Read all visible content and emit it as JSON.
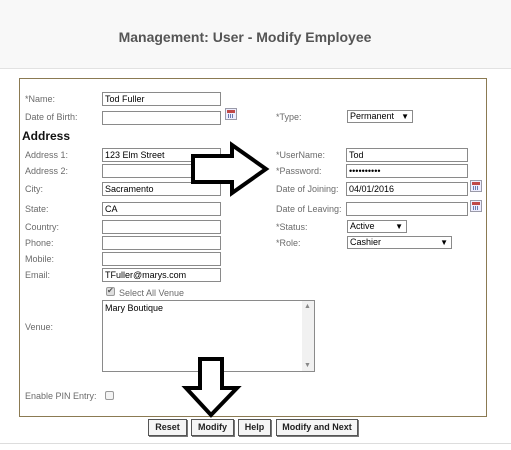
{
  "page_title": "Management: User - Modify Employee",
  "left": {
    "name_label": "*Name:",
    "name_value": "Tod Fuller",
    "dob_label": "Date of Birth:",
    "dob_value": "",
    "address_heading": "Address",
    "address1_label": "Address 1:",
    "address1_value": "123 Elm Street",
    "address2_label": "Address 2:",
    "address2_value": "",
    "city_label": "City:",
    "city_value": "Sacramento",
    "state_label": "State:",
    "state_value": "CA",
    "country_label": "Country:",
    "country_value": "",
    "phone_label": "Phone:",
    "phone_value": "",
    "mobile_label": "Mobile:",
    "mobile_value": "",
    "email_label": "Email:",
    "email_value": "TFuller@marys.com",
    "select_all_venue_label": "Select All Venue",
    "select_all_venue_checked": true,
    "venue_label": "Venue:",
    "venue_items": [
      "Mary Boutique"
    ],
    "pin_label": "Enable PIN Entry:",
    "pin_checked": false
  },
  "right": {
    "type_label": "*Type:",
    "type_value": "Permanent",
    "username_label": "*UserName:",
    "username_value": "Tod",
    "password_label": "*Password:",
    "password_value": "••••••••••",
    "doj_label": "Date of Joining:",
    "doj_value": "04/01/2016",
    "dol_label": "Date of Leaving:",
    "dol_value": "",
    "status_label": "*Status:",
    "status_value": "Active",
    "role_label": "*Role:",
    "role_value": "Cashier"
  },
  "buttons": {
    "reset": "Reset",
    "modify": "Modify",
    "help": "Help",
    "modify_next": "Modify and Next"
  },
  "icons": {
    "calendar": "calendar-icon",
    "dropdown": "chevron-down-icon",
    "annotation_arrows": "arrow-outline-icon"
  }
}
